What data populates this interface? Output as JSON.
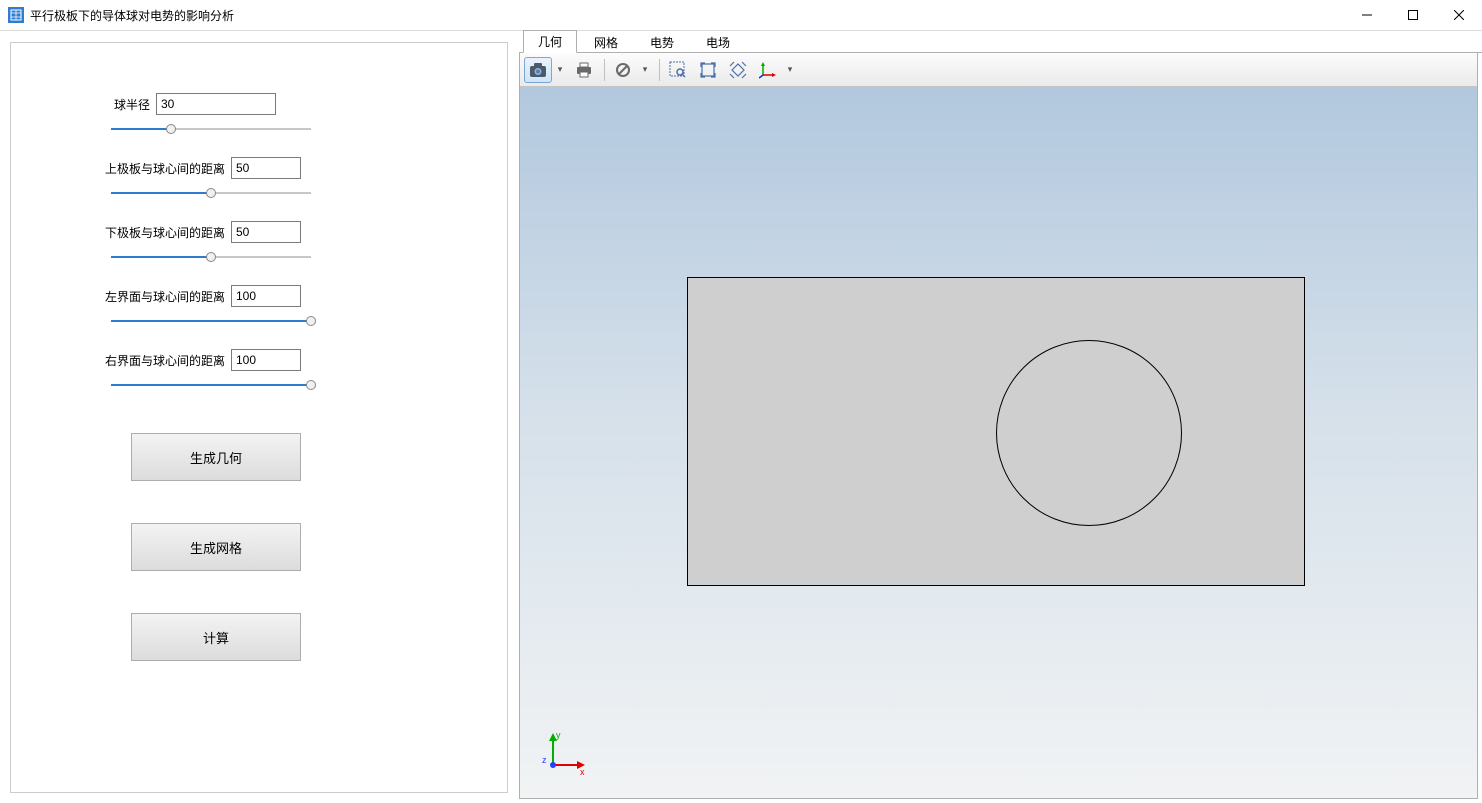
{
  "window": {
    "title": "平行极板下的导体球对电势的影响分析"
  },
  "params": {
    "radius": {
      "label": "球半径",
      "value": "30",
      "pct": 30
    },
    "distTop": {
      "label": "上极板与球心间的距离",
      "value": "50",
      "pct": 50
    },
    "distBot": {
      "label": "下极板与球心间的距离",
      "value": "50",
      "pct": 50
    },
    "distLeft": {
      "label": "左界面与球心间的距离",
      "value": "100",
      "pct": 100
    },
    "distRight": {
      "label": "右界面与球心间的距离",
      "value": "100",
      "pct": 100
    }
  },
  "buttons": {
    "genGeom": "生成几何",
    "genMesh": "生成网格",
    "compute": "计算"
  },
  "tabs": {
    "geom": "几何",
    "mesh": "网格",
    "pot": "电势",
    "field": "电场"
  },
  "axis": {
    "x": "x",
    "y": "y",
    "z": "z"
  }
}
